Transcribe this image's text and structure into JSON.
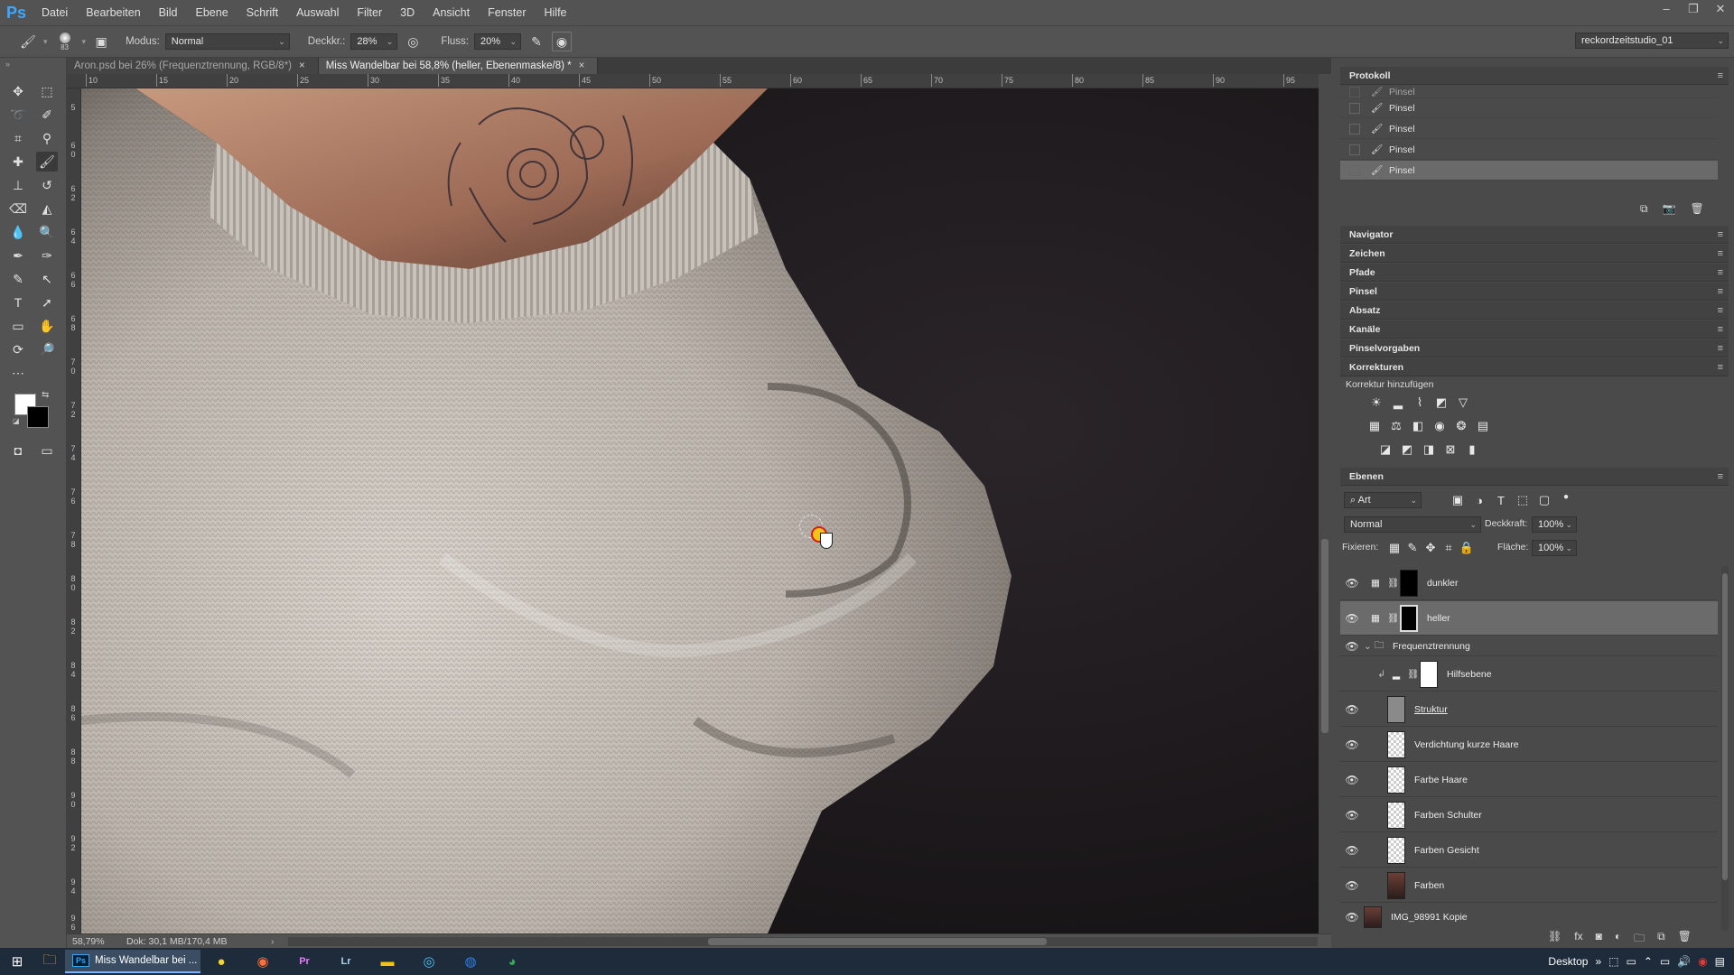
{
  "menubar": {
    "logo": "Ps",
    "items": [
      "Datei",
      "Bearbeiten",
      "Bild",
      "Ebene",
      "Schrift",
      "Auswahl",
      "Filter",
      "3D",
      "Ansicht",
      "Fenster",
      "Hilfe"
    ]
  },
  "options": {
    "brush_size": "83",
    "modus_label": "Modus:",
    "modus_value": "Normal",
    "deckkraft_label": "Deckkr.:",
    "deckkraft_value": "28%",
    "fluss_label": "Fluss:",
    "fluss_value": "20%",
    "workspace": "reckordzeitstudio_01"
  },
  "tabs": [
    {
      "label": "Aron.psd bei 26% (Frequenztrennung, RGB/8*)",
      "close": "×"
    },
    {
      "label": "Miss Wandelbar bei 58,8% (heller, Ebenenmaske/8) *",
      "close": "×"
    }
  ],
  "ruler_top": [
    "10",
    "15",
    "20",
    "25",
    "30",
    "35",
    "40",
    "45",
    "50",
    "55",
    "60",
    "65",
    "70",
    "75",
    "80",
    "85",
    "90",
    "95"
  ],
  "ruler_left": [
    "5",
    "6 0",
    "6 2",
    "6 4",
    "6 6",
    "6 8",
    "7 0",
    "7 2",
    "7 4",
    "7 6",
    "7 8",
    "8 0",
    "8 2",
    "8 4",
    "8 6",
    "8 8",
    "9 0",
    "9 2",
    "9 4",
    "9 6"
  ],
  "status": {
    "zoom": "58,79%",
    "doc": "Dok: 30,1 MB/170,4 MB"
  },
  "protokoll": {
    "title": "Protokoll",
    "items": [
      "Pinsel",
      "Pinsel",
      "Pinsel",
      "Pinsel",
      "Pinsel"
    ]
  },
  "collapsed_panels": [
    "Navigator",
    "Zeichen",
    "Pfade",
    "Pinsel",
    "Absatz",
    "Kanäle",
    "Pinselvorgaben"
  ],
  "korrekturen": {
    "title": "Korrekturen",
    "subtitle": "Korrektur hinzufügen"
  },
  "ebenen": {
    "title": "Ebenen",
    "filter": "Art",
    "blend_mode": "Normal",
    "deckkraft_label": "Deckkraft:",
    "deckkraft_value": "100%",
    "fixieren_label": "Fixieren:",
    "flaeche_label": "Fläche:",
    "flaeche_value": "100%",
    "layers": [
      {
        "name": "dunkler"
      },
      {
        "name": "heller"
      },
      {
        "name": "Frequenztrennung"
      },
      {
        "name": "Hilfsebene"
      },
      {
        "name": "Struktur"
      },
      {
        "name": "Verdichtung kurze Haare"
      },
      {
        "name": "Farbe Haare"
      },
      {
        "name": "Farben Schulter"
      },
      {
        "name": "Farben Gesicht"
      },
      {
        "name": "Farben"
      },
      {
        "name": "IMG_98991 Kopie"
      }
    ]
  },
  "taskbar": {
    "active_app": "Miss Wandelbar bei ...",
    "desktop": "Desktop"
  }
}
